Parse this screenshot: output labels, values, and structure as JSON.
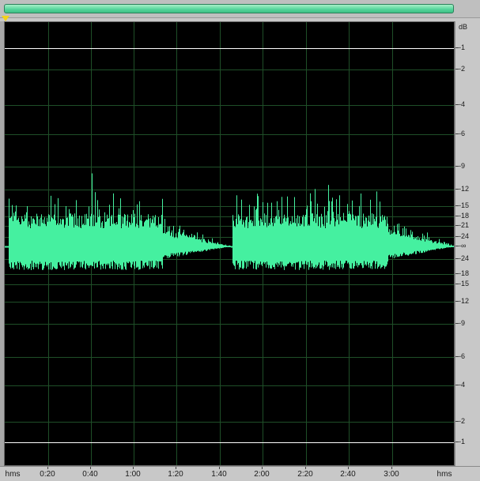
{
  "colors": {
    "waveform": "#45f0a0",
    "background": "#000000",
    "grid": "#1f4f28",
    "reference_line": "#ffffff",
    "overview_range": "#54d49a",
    "playhead": "#f3d21a"
  },
  "db_ruler": {
    "unit_label": "dB",
    "labels": [
      "-1",
      "-2",
      "-4",
      "-6",
      "-9",
      "-12",
      "-15",
      "-18",
      "-21",
      "-24",
      "-∞",
      "-24",
      "-18",
      "-15",
      "-12",
      "-9",
      "-6",
      "-4",
      "-2",
      "-1"
    ]
  },
  "time_ruler": {
    "left_unit": "hms",
    "right_unit": "hms",
    "labels": [
      "0:20",
      "0:40",
      "1:00",
      "1:20",
      "1:40",
      "2:00",
      "2:20",
      "2:40",
      "3:00"
    ]
  },
  "waveform": {
    "description_icon": "waveform-icon",
    "segments": [
      {
        "start": "0:00",
        "end": "1:45"
      },
      {
        "start": "1:48",
        "end": "3:30"
      }
    ]
  }
}
